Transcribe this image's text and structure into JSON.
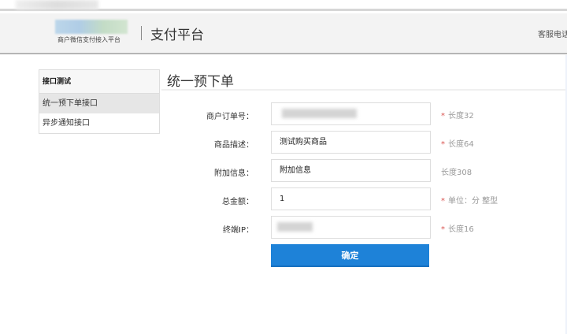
{
  "header": {
    "logo_subtitle": "商户微信支付接入平台",
    "platform_title": "支付平台",
    "service_text": "客服电话"
  },
  "sidebar": {
    "heading": "接口测试",
    "items": [
      {
        "label": "统一预下单接口",
        "active": true
      },
      {
        "label": "异步通知接口",
        "active": false
      }
    ]
  },
  "main": {
    "title": "统一预下单",
    "fields": [
      {
        "label": "商户订单号：",
        "value": "",
        "hint": "长度32",
        "required": true
      },
      {
        "label": "商品描述：",
        "value": "测试购买商品",
        "hint": "长度64",
        "required": true
      },
      {
        "label": "附加信息：",
        "value": "附加信息",
        "hint": "长度308",
        "required": false
      },
      {
        "label": "总金额：",
        "value": "1",
        "hint": "单位：分 整型",
        "required": true
      },
      {
        "label": "终端IP：",
        "value": "",
        "hint": "长度16",
        "required": true
      }
    ],
    "required_mark": "*",
    "submit_label": "确定"
  },
  "colors": {
    "accent": "#1e82d8",
    "required": "#d9534f"
  }
}
